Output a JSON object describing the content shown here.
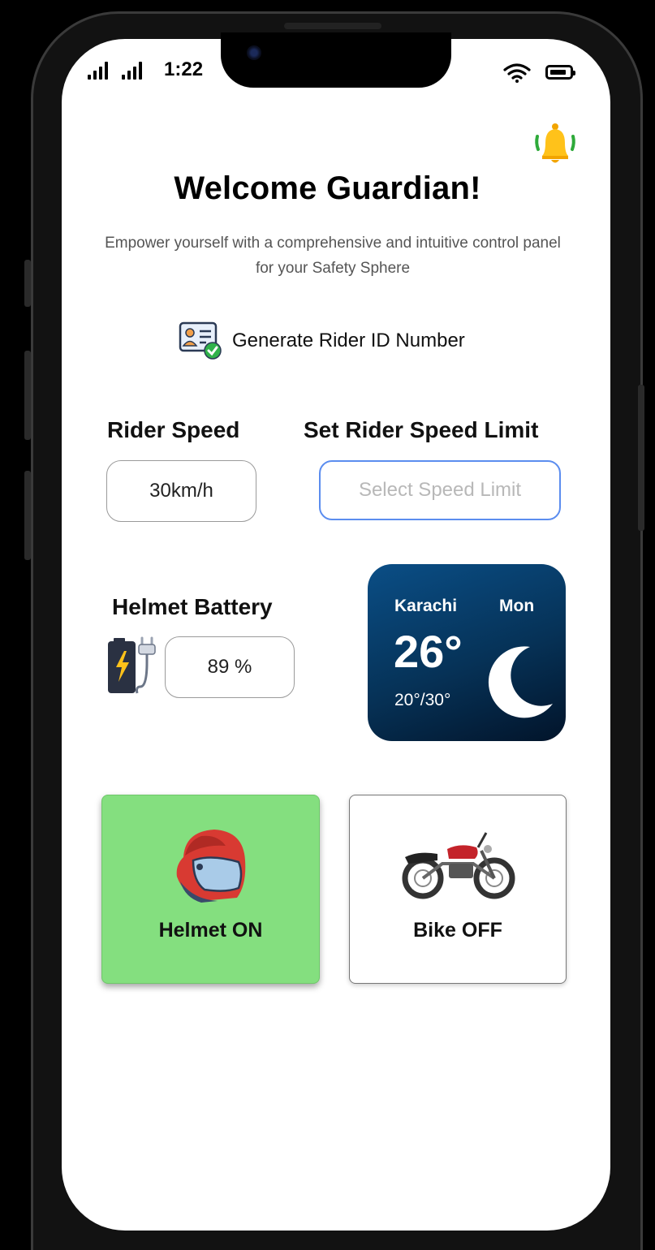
{
  "status_bar": {
    "time": "1:22"
  },
  "header": {
    "title": "Welcome Guardian!",
    "subtitle": "Empower yourself with a comprehensive and intuitive control panel for your Safety Sphere"
  },
  "actions": {
    "generate_id_label": "Generate Rider ID Number"
  },
  "speed": {
    "rider_speed_label": "Rider Speed",
    "rider_speed_value": "30km/h",
    "limit_label": "Set Rider Speed Limit",
    "limit_placeholder": "Select Speed Limit"
  },
  "battery": {
    "label": "Helmet Battery",
    "value": "89 %"
  },
  "weather": {
    "city": "Karachi",
    "day": "Mon",
    "temp": "26°",
    "range": "20°/30°"
  },
  "cards": {
    "helmet_label": "Helmet ON",
    "bike_label": "Bike OFF"
  },
  "colors": {
    "helmet_card_bg": "#84df7f",
    "weather_bg": "#063257",
    "select_border": "#5b8def"
  }
}
